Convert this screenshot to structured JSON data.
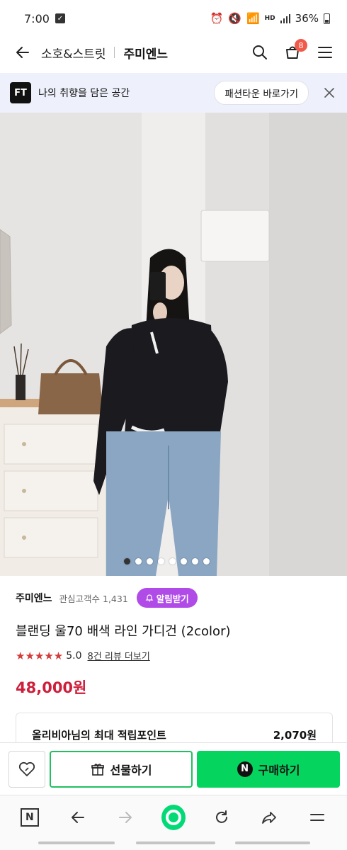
{
  "status_bar": {
    "time": "7:00",
    "battery": "36%",
    "network_label": "HD"
  },
  "header": {
    "breadcrumb": "소호&스트릿",
    "shop_title": "주미엔느",
    "cart_count": "8"
  },
  "promo": {
    "logo": "FT",
    "text": "나의 취향을 담은 공간",
    "link_label": "패션타운 바로가기"
  },
  "gallery": {
    "image_count": 8,
    "active_index": 0
  },
  "product": {
    "shop_name": "주미엔느",
    "followers": "관심고객수 1,431",
    "alert_label": "알림받기",
    "title": "블랜딩 울70 배색 라인 가디건 (2color)",
    "stars": "★★★★★",
    "rating": "5.0",
    "review_link": "8건 리뷰 더보기",
    "price": "48,000원"
  },
  "points": {
    "label": "올리비아님의 최대 적립포인트",
    "value": "2,070원"
  },
  "purchase_bar": {
    "gift_label": "선물하기",
    "buy_label": "구매하기",
    "buy_badge": "N"
  },
  "browser_bar": {
    "home_label": "N"
  },
  "colors": {
    "accent_green": "#05d55f",
    "price_red": "#cc1f3b",
    "alert_purple": "#b04be8",
    "badge_red": "#f05a4a"
  }
}
